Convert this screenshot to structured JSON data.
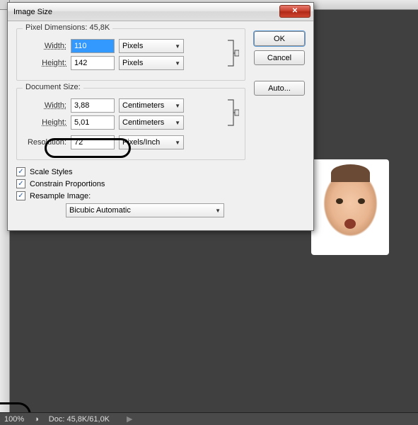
{
  "dialog": {
    "title": "Image Size",
    "buttons": {
      "ok": "OK",
      "cancel": "Cancel",
      "auto": "Auto..."
    },
    "pixel_dimensions": {
      "title": "Pixel Dimensions:",
      "summary": "45,8K",
      "width_label": "Width:",
      "width_value": "110",
      "width_unit": "Pixels",
      "height_label": "Height:",
      "height_value": "142",
      "height_unit": "Pixels"
    },
    "document_size": {
      "title": "Document Size:",
      "width_label": "Width:",
      "width_value": "3,88",
      "width_unit": "Centimeters",
      "height_label": "Height:",
      "height_value": "5,01",
      "height_unit": "Centimeters",
      "resolution_label": "Resolution:",
      "resolution_value": "72",
      "resolution_unit": "Pixels/Inch"
    },
    "scale_styles": "Scale Styles",
    "constrain": "Constrain Proportions",
    "resample": "Resample Image:",
    "resample_method": "Bicubic Automatic"
  },
  "statusbar": {
    "zoom": "100%",
    "doc": "Doc: 45,8K/61,0K"
  }
}
